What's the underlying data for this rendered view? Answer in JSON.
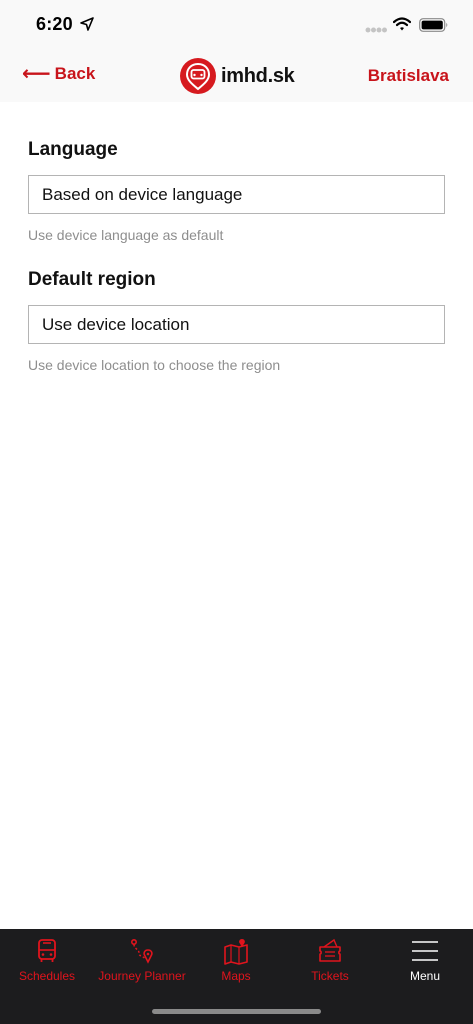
{
  "status_bar": {
    "time": "6:20",
    "location_icon": "location-arrow-icon",
    "signal_icon": "signal-dots-icon",
    "wifi_icon": "wifi-icon",
    "battery_icon": "battery-icon"
  },
  "nav": {
    "back_label": "Back",
    "back_icon": "left-arrow-icon",
    "logo_text": "imhd.sk",
    "region_label": "Bratislava"
  },
  "settings": {
    "language": {
      "title": "Language",
      "value": "Based on device language",
      "hint": "Use device language as default"
    },
    "region": {
      "title": "Default region",
      "value": "Use device location",
      "hint": "Use device location to choose the region"
    }
  },
  "tabs": [
    {
      "label": "Schedules",
      "icon": "bus-icon",
      "active": false
    },
    {
      "label": "Journey Planner",
      "icon": "route-icon",
      "active": false
    },
    {
      "label": "Maps",
      "icon": "map-icon",
      "active": false
    },
    {
      "label": "Tickets",
      "icon": "ticket-icon",
      "active": false
    },
    {
      "label": "Menu",
      "icon": "hamburger-icon",
      "active": true
    }
  ],
  "colors": {
    "accent": "#c8141b",
    "tab_bar": "#1c1c1e",
    "tab_inactive": "#e0141d",
    "tab_active": "#ffffff",
    "hint_text": "#8e8e8e"
  }
}
